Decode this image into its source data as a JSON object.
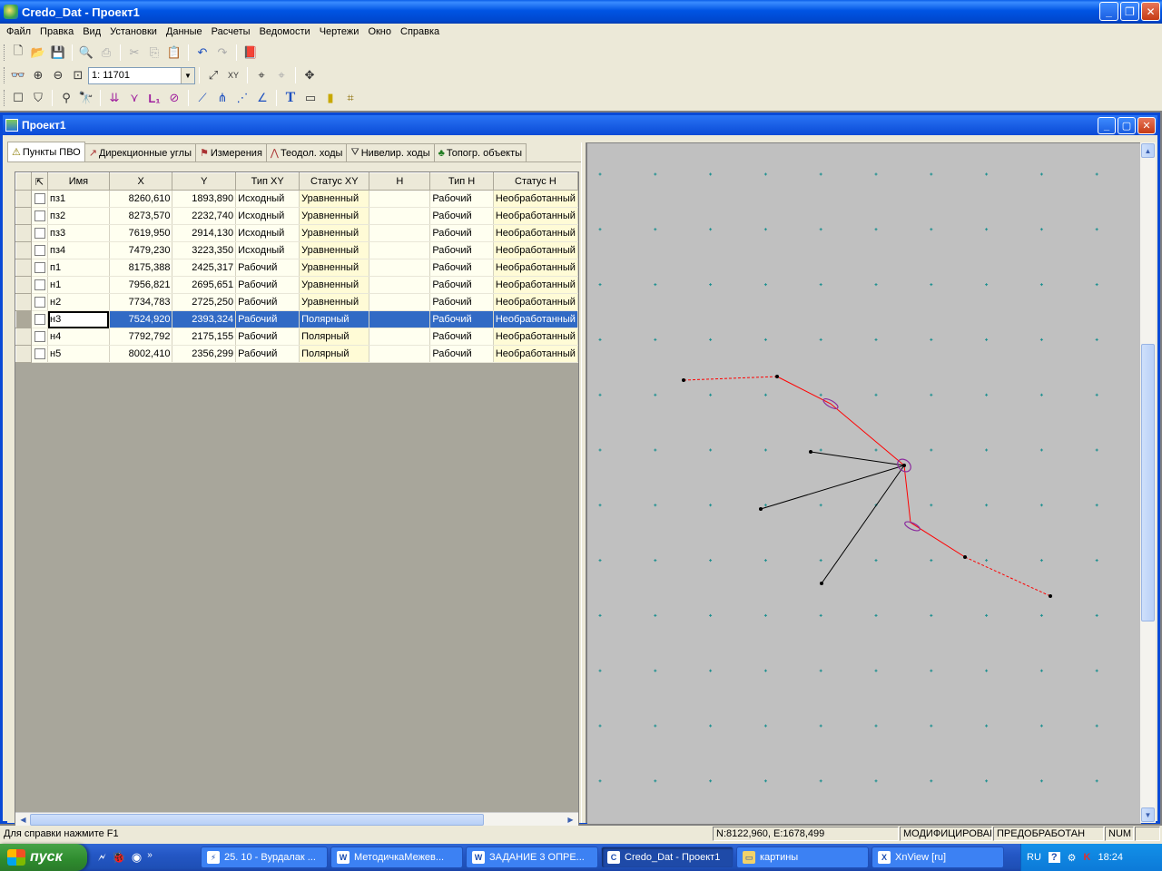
{
  "window": {
    "title": "Credo_Dat - Проект1"
  },
  "menu": [
    "Файл",
    "Правка",
    "Вид",
    "Установки",
    "Данные",
    "Расчеты",
    "Ведомости",
    "Чертежи",
    "Окно",
    "Справка"
  ],
  "toolbar": {
    "scale_value": "1: 11701"
  },
  "child_window": {
    "title": "Проект1"
  },
  "tabs": [
    {
      "label": "Пункты ПВО",
      "icon": "points-icon"
    },
    {
      "label": "Дирекционные углы",
      "icon": "direction-angle-icon"
    },
    {
      "label": "Измерения",
      "icon": "measurement-icon"
    },
    {
      "label": "Теодол. ходы",
      "icon": "theodolite-traverse-icon"
    },
    {
      "label": "Нивелир. ходы",
      "icon": "level-traverse-icon"
    },
    {
      "label": "Топогр. объекты",
      "icon": "tree-icon"
    }
  ],
  "table": {
    "headers": [
      "Имя",
      "X",
      "Y",
      "Тип  XY",
      "Статус XY",
      "H",
      "Тип H",
      "Статус H"
    ],
    "rows": [
      {
        "name": "пз1",
        "x": "8260,610",
        "y": "1893,890",
        "type_xy": "Исходный",
        "status_xy": "Уравненный",
        "h": "",
        "type_h": "Рабочий",
        "status_h": "Необработанный"
      },
      {
        "name": "пз2",
        "x": "8273,570",
        "y": "2232,740",
        "type_xy": "Исходный",
        "status_xy": "Уравненный",
        "h": "",
        "type_h": "Рабочий",
        "status_h": "Необработанный"
      },
      {
        "name": "пз3",
        "x": "7619,950",
        "y": "2914,130",
        "type_xy": "Исходный",
        "status_xy": "Уравненный",
        "h": "",
        "type_h": "Рабочий",
        "status_h": "Необработанный"
      },
      {
        "name": "пз4",
        "x": "7479,230",
        "y": "3223,350",
        "type_xy": "Исходный",
        "status_xy": "Уравненный",
        "h": "",
        "type_h": "Рабочий",
        "status_h": "Необработанный"
      },
      {
        "name": "п1",
        "x": "8175,388",
        "y": "2425,317",
        "type_xy": "Рабочий",
        "status_xy": "Уравненный",
        "h": "",
        "type_h": "Рабочий",
        "status_h": "Необработанный"
      },
      {
        "name": "н1",
        "x": "7956,821",
        "y": "2695,651",
        "type_xy": "Рабочий",
        "status_xy": "Уравненный",
        "h": "",
        "type_h": "Рабочий",
        "status_h": "Необработанный"
      },
      {
        "name": "н2",
        "x": "7734,783",
        "y": "2725,250",
        "type_xy": "Рабочий",
        "status_xy": "Уравненный",
        "h": "",
        "type_h": "Рабочий",
        "status_h": "Необработанный"
      },
      {
        "name": "н3",
        "x": "7524,920",
        "y": "2393,324",
        "type_xy": "Рабочий",
        "status_xy": "Полярный",
        "h": "",
        "type_h": "Рабочий",
        "status_h": "Необработанный",
        "selected": true
      },
      {
        "name": "н4",
        "x": "7792,792",
        "y": "2175,155",
        "type_xy": "Рабочий",
        "status_xy": "Полярный",
        "h": "",
        "type_h": "Рабочий",
        "status_h": "Необработанный"
      },
      {
        "name": "н5",
        "x": "8002,410",
        "y": "2356,299",
        "type_xy": "Рабочий",
        "status_xy": "Полярный",
        "h": "",
        "type_h": "Рабочий",
        "status_h": "Необработанный"
      }
    ]
  },
  "map": {
    "colors": {
      "background": "#c0c0c0",
      "grid_cross": "#1a8f8f",
      "traverse": "#ff0000",
      "polar": "#000000",
      "ellipse": "#8b2c9e"
    }
  },
  "statusbar": {
    "help": "Для справки  нажмите  F1",
    "coords": "N:8122,960, E:1678,499",
    "modified": "МОДИФИЦИРОВАН",
    "preprocessed": "ПРЕДОБРАБОТАН",
    "num": "NUM"
  },
  "taskbar": {
    "start_label": "пуск",
    "tasks": [
      {
        "label": "25. 10 - Вурдалак ...",
        "icon": "folder-app-icon"
      },
      {
        "label": "МетодичкаМежев...",
        "icon": "word-doc-icon"
      },
      {
        "label": "ЗАДАНИЕ 3 ОПРЕ...",
        "icon": "word-doc-icon"
      },
      {
        "label": "Credo_Dat - Проект1",
        "icon": "credo-app-icon",
        "active": true
      },
      {
        "label": "картины",
        "icon": "folder-icon"
      },
      {
        "label": "XnView [ru]",
        "icon": "xnview-icon"
      }
    ],
    "tray": {
      "lang": "RU",
      "time": "18:24"
    }
  }
}
